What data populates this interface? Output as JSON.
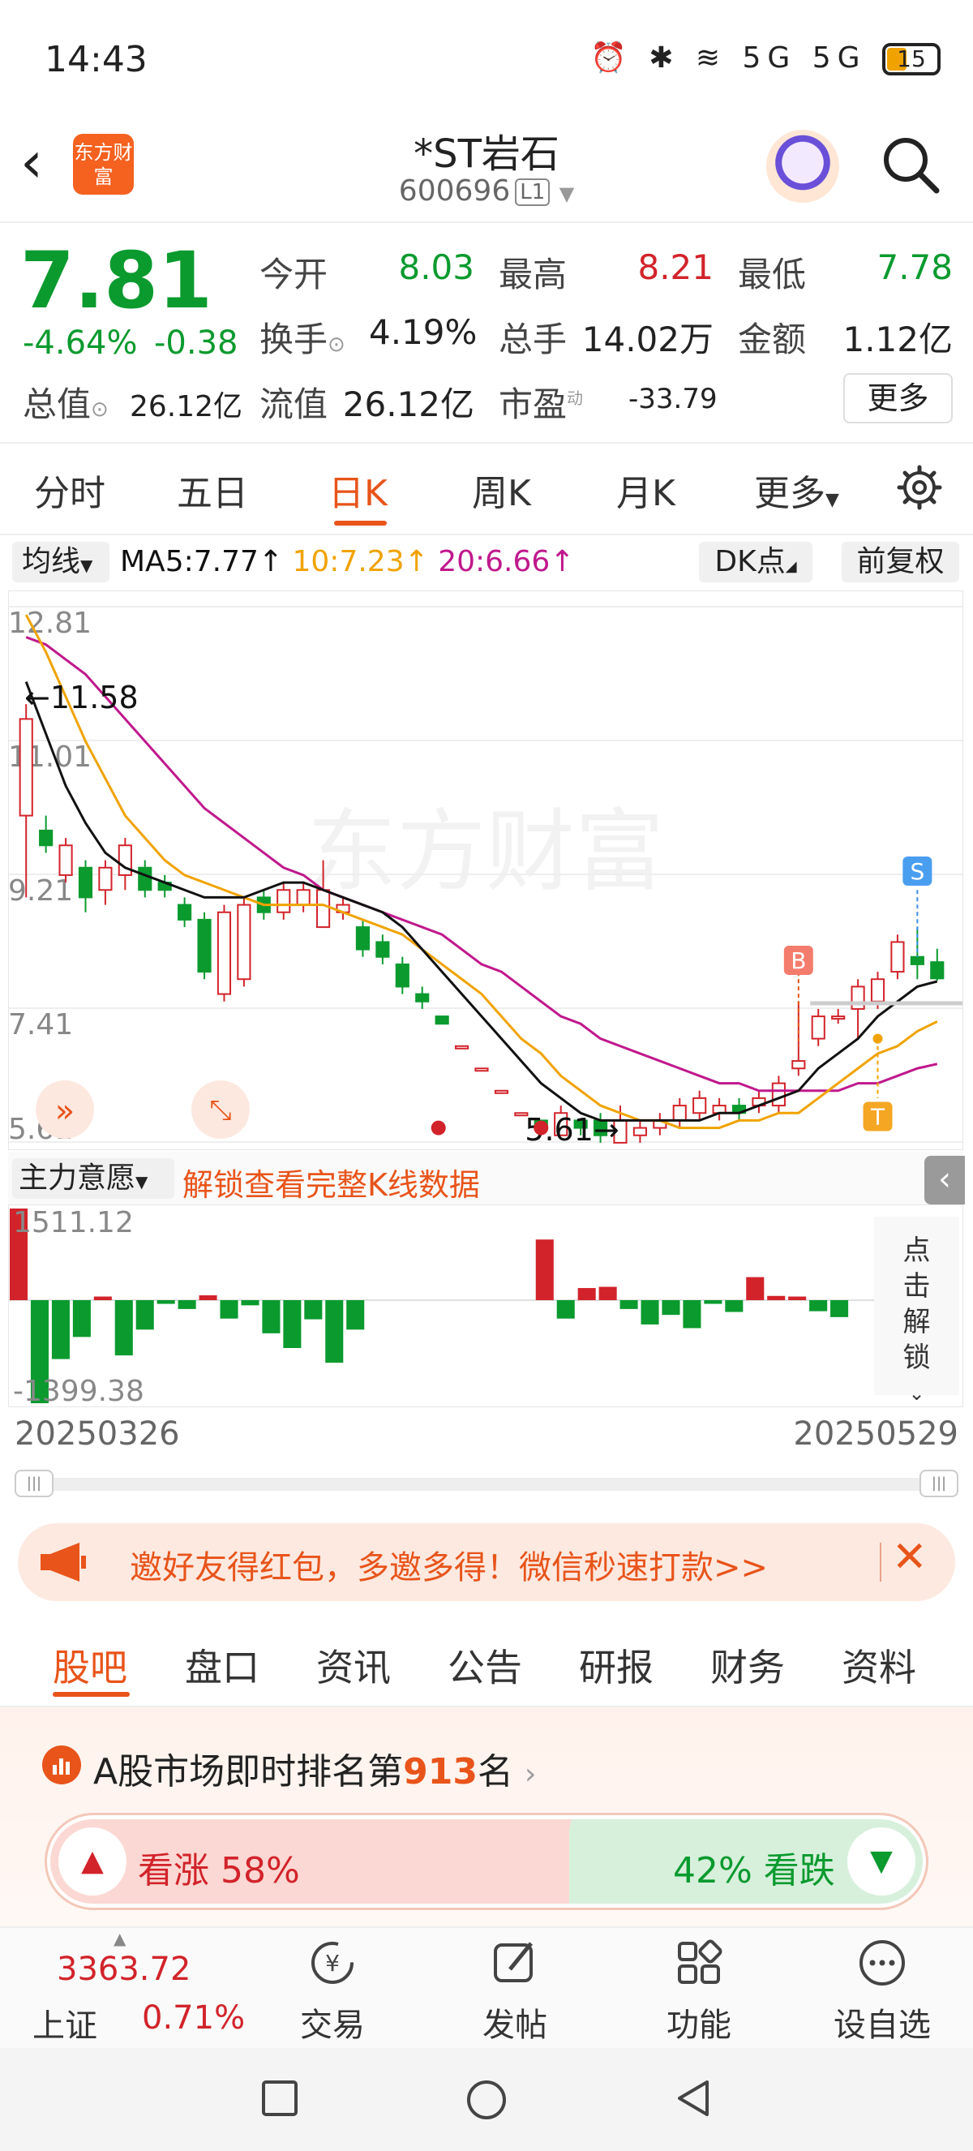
{
  "status_bar": {
    "time": "14:43",
    "icons": "⏰ ✱ ≋ 5G 5G",
    "battery": "15"
  },
  "header": {
    "stock_name": "*ST岩石",
    "stock_code": "600696",
    "level": "L1",
    "logo_text": "东方财富"
  },
  "quote": {
    "price": "7.81",
    "change_pct": "-4.64%",
    "change_amt": "-0.38",
    "mcap_label": "总值",
    "mcap_value": "26.12亿",
    "open_label": "今开",
    "open_value": "8.03",
    "high_label": "最高",
    "high_value": "8.21",
    "low_label": "最低",
    "low_value": "7.78",
    "turnover_label": "换手",
    "turnover_value": "4.19%",
    "volume_label": "总手",
    "volume_value": "14.02万",
    "amount_label": "金额",
    "amount_value": "1.12亿",
    "float_label": "流值",
    "float_value": "26.12亿",
    "pe_label": "市盈",
    "pe_sup": "动",
    "pe_value": "-33.79",
    "more_label": "更多"
  },
  "chart_tabs": [
    "分时",
    "五日",
    "日K",
    "周K",
    "月K",
    "更多"
  ],
  "ma_row": {
    "select": "均线",
    "ma5": "MA5:7.77↑",
    "ma10": "10:7.23↑",
    "ma20": "20:6.66↑",
    "dk": "DK点",
    "fuquan": "前复权"
  },
  "colors": {
    "up": "#d2232a",
    "down": "#0a9a2e",
    "accent": "#e8541a",
    "ma5": "#111111",
    "ma10": "#f0a300",
    "ma20": "#c0188c"
  },
  "chart_data": {
    "type": "candlestick",
    "y_ticks": [
      "12.81",
      "11.01",
      "9.21",
      "7.41",
      "5.61"
    ],
    "y_range": [
      5.61,
      12.81
    ],
    "high_label": "11.58",
    "low_label": "5.61",
    "candles": [
      [
        10.0,
        11.3,
        8.9,
        11.5
      ],
      [
        9.8,
        9.6,
        9.5,
        10.0
      ],
      [
        9.2,
        9.6,
        9.1,
        9.7
      ],
      [
        9.3,
        8.9,
        8.7,
        9.4
      ],
      [
        9.0,
        9.3,
        8.8,
        9.4
      ],
      [
        9.2,
        9.6,
        9.0,
        9.7
      ],
      [
        9.3,
        9.0,
        8.9,
        9.4
      ],
      [
        9.1,
        9.0,
        8.9,
        9.2
      ],
      [
        8.8,
        8.6,
        8.5,
        8.9
      ],
      [
        8.6,
        7.9,
        7.8,
        8.7
      ],
      [
        7.6,
        8.7,
        7.5,
        8.8
      ],
      [
        7.8,
        8.8,
        7.7,
        8.9
      ],
      [
        8.9,
        8.7,
        8.6,
        9.0
      ],
      [
        8.7,
        9.0,
        8.6,
        9.1
      ],
      [
        8.8,
        9.0,
        8.7,
        9.1
      ],
      [
        8.5,
        9.0,
        8.5,
        9.4
      ],
      [
        8.7,
        8.8,
        8.6,
        8.9
      ],
      [
        8.5,
        8.2,
        8.1,
        8.6
      ],
      [
        8.3,
        8.1,
        8.0,
        8.4
      ],
      [
        8.0,
        7.7,
        7.6,
        8.1
      ],
      [
        7.6,
        7.5,
        7.4,
        7.7
      ],
      [
        7.3,
        7.2,
        7.2,
        7.3
      ],
      [
        6.9,
        6.9,
        6.9,
        6.9
      ],
      [
        6.6,
        6.6,
        6.6,
        6.6
      ],
      [
        6.3,
        6.3,
        6.3,
        6.3
      ],
      [
        6.0,
        6.0,
        6.0,
        6.0
      ],
      [
        5.9,
        5.8,
        5.7,
        5.9
      ],
      [
        5.7,
        6.0,
        5.7,
        6.1
      ],
      [
        5.9,
        5.8,
        5.7,
        5.9
      ],
      [
        5.9,
        5.7,
        5.6,
        6.0
      ],
      [
        5.6,
        5.9,
        5.6,
        6.1
      ],
      [
        5.7,
        5.8,
        5.6,
        5.9
      ],
      [
        5.8,
        5.9,
        5.7,
        6.0
      ],
      [
        5.9,
        6.1,
        5.8,
        6.2
      ],
      [
        6.0,
        6.2,
        5.9,
        6.3
      ],
      [
        6.0,
        6.1,
        5.9,
        6.2
      ],
      [
        6.1,
        6.0,
        5.9,
        6.2
      ],
      [
        6.1,
        6.2,
        6.0,
        6.3
      ],
      [
        6.1,
        6.4,
        6.0,
        6.5
      ],
      [
        6.6,
        6.7,
        6.5,
        7.5
      ],
      [
        7.0,
        7.3,
        6.9,
        7.4
      ],
      [
        7.3,
        7.3,
        7.2,
        7.4
      ],
      [
        7.4,
        7.7,
        7.0,
        7.8
      ],
      [
        7.5,
        7.8,
        7.4,
        7.9
      ],
      [
        7.9,
        8.3,
        7.8,
        8.4
      ],
      [
        8.1,
        8.0,
        7.8,
        8.5
      ],
      [
        8.03,
        7.81,
        7.78,
        8.21
      ]
    ],
    "ma5": [
      11.8,
      11.1,
      10.4,
      9.9,
      9.5,
      9.3,
      9.2,
      9.1,
      9.0,
      8.9,
      8.9,
      8.9,
      9.0,
      9.1,
      9.1,
      9.0,
      8.9,
      8.8,
      8.7,
      8.5,
      8.2,
      7.9,
      7.6,
      7.3,
      7.0,
      6.7,
      6.4,
      6.2,
      6.0,
      5.9,
      5.9,
      5.9,
      5.9,
      5.9,
      5.9,
      6.0,
      6.0,
      6.1,
      6.2,
      6.3,
      6.6,
      6.8,
      7.0,
      7.3,
      7.5,
      7.7,
      7.77
    ],
    "ma10": [
      12.7,
      12.2,
      11.6,
      11.0,
      10.5,
      10.0,
      9.7,
      9.4,
      9.2,
      9.1,
      9.0,
      8.9,
      8.8,
      8.8,
      8.8,
      8.8,
      8.7,
      8.6,
      8.5,
      8.4,
      8.2,
      8.0,
      7.8,
      7.6,
      7.3,
      7.0,
      6.8,
      6.5,
      6.3,
      6.1,
      6.0,
      5.9,
      5.9,
      5.8,
      5.8,
      5.8,
      5.9,
      5.9,
      6.0,
      6.0,
      6.2,
      6.4,
      6.6,
      6.8,
      6.9,
      7.1,
      7.23
    ],
    "ma20": [
      12.4,
      12.3,
      12.1,
      11.9,
      11.6,
      11.3,
      11.0,
      10.7,
      10.4,
      10.1,
      9.9,
      9.7,
      9.5,
      9.3,
      9.2,
      9.0,
      8.9,
      8.8,
      8.7,
      8.6,
      8.5,
      8.4,
      8.2,
      8.0,
      7.9,
      7.7,
      7.5,
      7.3,
      7.2,
      7.0,
      6.9,
      6.8,
      6.7,
      6.6,
      6.5,
      6.4,
      6.4,
      6.3,
      6.3,
      6.3,
      6.3,
      6.3,
      6.4,
      6.4,
      6.5,
      6.6,
      6.66
    ],
    "markers": {
      "B": "B",
      "S": "S",
      "T": "T"
    }
  },
  "indicator": {
    "select": "主力意愿",
    "unlock_text": "解锁查看完整K线数据",
    "max_label": "1511.12",
    "min_label": "-1399.38",
    "side_unlock": "点击解锁",
    "values": [
      1511,
      -1400,
      -800,
      -500,
      60,
      -750,
      -400,
      -50,
      -120,
      80,
      -250,
      -70,
      -450,
      -650,
      -260,
      -850,
      -400,
      0,
      0,
      0,
      0,
      0,
      0,
      0,
      0,
      1000,
      -250,
      200,
      220,
      -120,
      -330,
      -200,
      -380,
      -50,
      -160,
      380,
      70,
      60,
      -150,
      -230
    ]
  },
  "dates": {
    "start": "20250326",
    "end": "20250529"
  },
  "promo": {
    "text": "邀好友得红包，多邀多得！微信秒速打款>>"
  },
  "sec_tabs": [
    "股吧",
    "盘口",
    "资讯",
    "公告",
    "研报",
    "财务",
    "资料"
  ],
  "rank": {
    "prefix": "A股市场即时排名第",
    "number": "913",
    "suffix": "名"
  },
  "vote": {
    "up": "看涨 58%",
    "down": "42% 看跌"
  },
  "index": {
    "value": "3363.72",
    "name": "上证",
    "pct": "0.71%"
  },
  "toolbar": [
    "交易",
    "发帖",
    "功能",
    "设自选"
  ]
}
